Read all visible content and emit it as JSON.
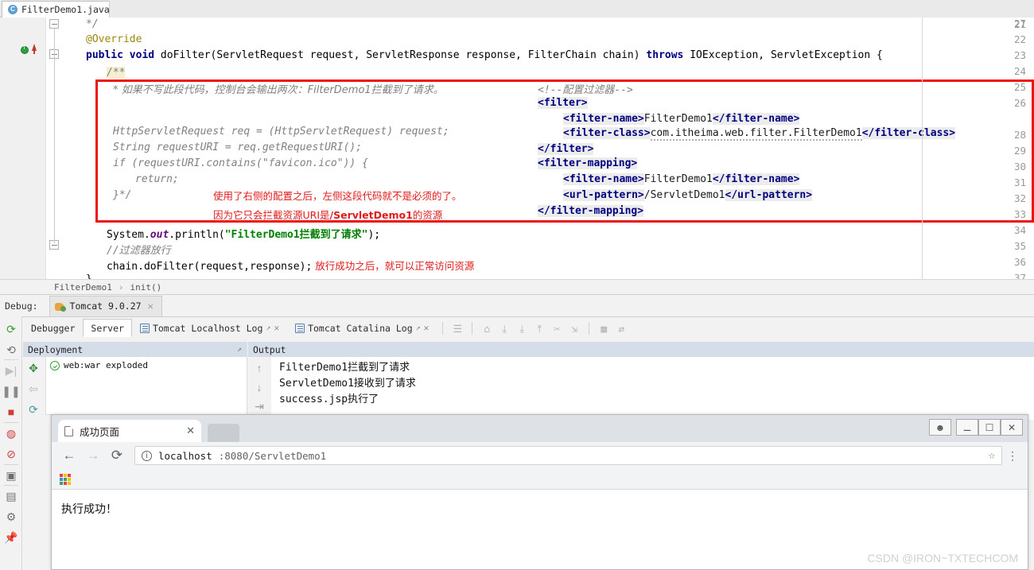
{
  "editor": {
    "tab": {
      "label": "FilterDemo1.java",
      "icon": "java-class-icon",
      "close": "✕"
    },
    "line_numbers": [
      "21",
      "22",
      "23",
      "24",
      "25",
      "26",
      "27",
      "28",
      "29",
      "30",
      "31",
      "32",
      "33",
      "34",
      "35",
      "36",
      "37"
    ],
    "code_lines": [
      {
        "n": 21,
        "text": "*/"
      },
      {
        "n": 22,
        "text": "@Override"
      },
      {
        "n": 23,
        "text": "public void doFilter(ServletRequest request, ServletResponse response, FilterChain chain) throws IOException, ServletException {"
      },
      {
        "n": 24,
        "text": "/**"
      },
      {
        "n": 25,
        "text": "* 如果不写此段代码，控制台会输出两次：FilterDemo1拦截到了请求。"
      },
      {
        "n": 26,
        "text": ""
      },
      {
        "n": 27,
        "text": "HttpServletRequest req = (HttpServletRequest) request;"
      },
      {
        "n": 28,
        "text": "String requestURI = req.getRequestURI();"
      },
      {
        "n": 29,
        "text": "if (requestURI.contains(\"favicon.ico\")) {"
      },
      {
        "n": 30,
        "text": "return;"
      },
      {
        "n": 31,
        "text": "}*/"
      },
      {
        "n": 34,
        "text": "System.out.println(\"FilterDemo1拦截到了请求\");"
      },
      {
        "n": 35,
        "text": "//过滤器放行"
      },
      {
        "n": 36,
        "text": "chain.doFilter(request,response);"
      },
      {
        "n": 37,
        "text": "}"
      }
    ],
    "kw_public": "public",
    "kw_void": "void",
    "kw_throws": "throws",
    "sig_method": " doFilter(ServletRequest request, ServletResponse response, FilterChain chain) ",
    "sig_tail": " IOException, ServletException {",
    "annotation": "@Override",
    "close_comment": "*/",
    "javadoc_open": "/**",
    "javadoc_line": "* 如果不写此段代码，控制台会输出两次：FilterDemo1拦截到了请求。",
    "code_req": "HttpServletRequest req = (HttpServletRequest) request;",
    "code_uri": "String requestURI = req.getRequestURI();",
    "code_if": "if (requestURI.contains(\"favicon.ico\")) {",
    "code_return": "return;",
    "code_endcomment": "}*/",
    "note_1": "使用了右侧的配置之后，左侧这段代码就不是必须的了。",
    "note_2a": "因为它只会拦截资源URI是",
    "note_2b": "/ServletDemo1",
    "note_2c": "的资源",
    "sysout_a": "System.",
    "sysout_b": "out",
    "sysout_c": ".println(",
    "sysout_str": "\"FilterDemo1拦截到了请求\"",
    "sysout_d": ");",
    "comment_pass": "//过滤器放行",
    "chain_call": "chain.doFilter(request,response);",
    "note_3": "放行成功之后，就可以正常访问资源",
    "brace_close": "}",
    "xml": {
      "comment": "<!--配置过滤器-->",
      "filter_open": "<filter>",
      "fname_open": "<filter-name>",
      "fname_val": "FilterDemo1",
      "fname_close": "</filter-name>",
      "fclass_open": "<filter-class>",
      "fclass_val": "com.itheima.web.filter.FilterDemo1",
      "fclass_close": "</filter-class>",
      "filter_close": "</filter>",
      "fmap_open": "<filter-mapping>",
      "url_open": "<url-pattern>",
      "url_val": "/ServletDemo1",
      "url_close": "</url-pattern>",
      "fmap_close": "</filter-mapping>"
    },
    "highlight_color": "#ee1111"
  },
  "breadcrumb": {
    "class": "FilterDemo1",
    "sep": "›",
    "method": "init()"
  },
  "debug": {
    "label": "Debug:",
    "run_config": "Tomcat 9.0.27",
    "run_close": "✕",
    "tabs": [
      {
        "label": "Debugger",
        "active": false,
        "icon": "none"
      },
      {
        "label": "Server",
        "active": true,
        "icon": "none"
      },
      {
        "label": "Tomcat Localhost Log",
        "active": false,
        "icon": "log-icon",
        "pin": "↗",
        "close": "✕"
      },
      {
        "label": "Tomcat Catalina Log",
        "active": false,
        "icon": "log-icon",
        "pin": "↗",
        "close": "✕"
      }
    ],
    "toolbar_icons": [
      "menu-icon",
      "soft-wrap-icon",
      "scroll-down-icon",
      "download-icon",
      "upload-icon",
      "kill-icon",
      "thread-dump-icon",
      "table-icon",
      "compare-icon"
    ],
    "deployment": {
      "header": "Deployment",
      "pin": "↗",
      "item": "web:war exploded",
      "status_icon": "ok-check-icon"
    },
    "output": {
      "header": "Output",
      "lines": [
        "FilterDemo1拦截到了请求",
        "ServletDemo1接收到了请求",
        "success.jsp执行了"
      ]
    },
    "left_rail_icons": [
      "rerun-icon",
      "restart-icon",
      "resume-icon",
      "pause-icon",
      "stop-icon",
      "breakpoints-icon",
      "mute-breakpoints-icon",
      "camera-icon",
      "layout-icon",
      "settings-icon",
      "pin-icon"
    ]
  },
  "browser": {
    "tab": {
      "title": "成功页面",
      "close": "✕",
      "icon": "page-icon"
    },
    "window_controls": [
      "profile-icon",
      "minimize-icon",
      "maximize-icon",
      "close-icon"
    ],
    "nav": {
      "back": "←",
      "forward": "→",
      "reload": "⟳"
    },
    "url_host": "localhost",
    "url_rest": ":8080/ServletDemo1",
    "star": "☆",
    "menu": "⋮",
    "bookmarks_icon": "apps-grid-icon",
    "page_text": "执行成功！"
  },
  "watermark": "CSDN @IRON~TXTECHCOM"
}
